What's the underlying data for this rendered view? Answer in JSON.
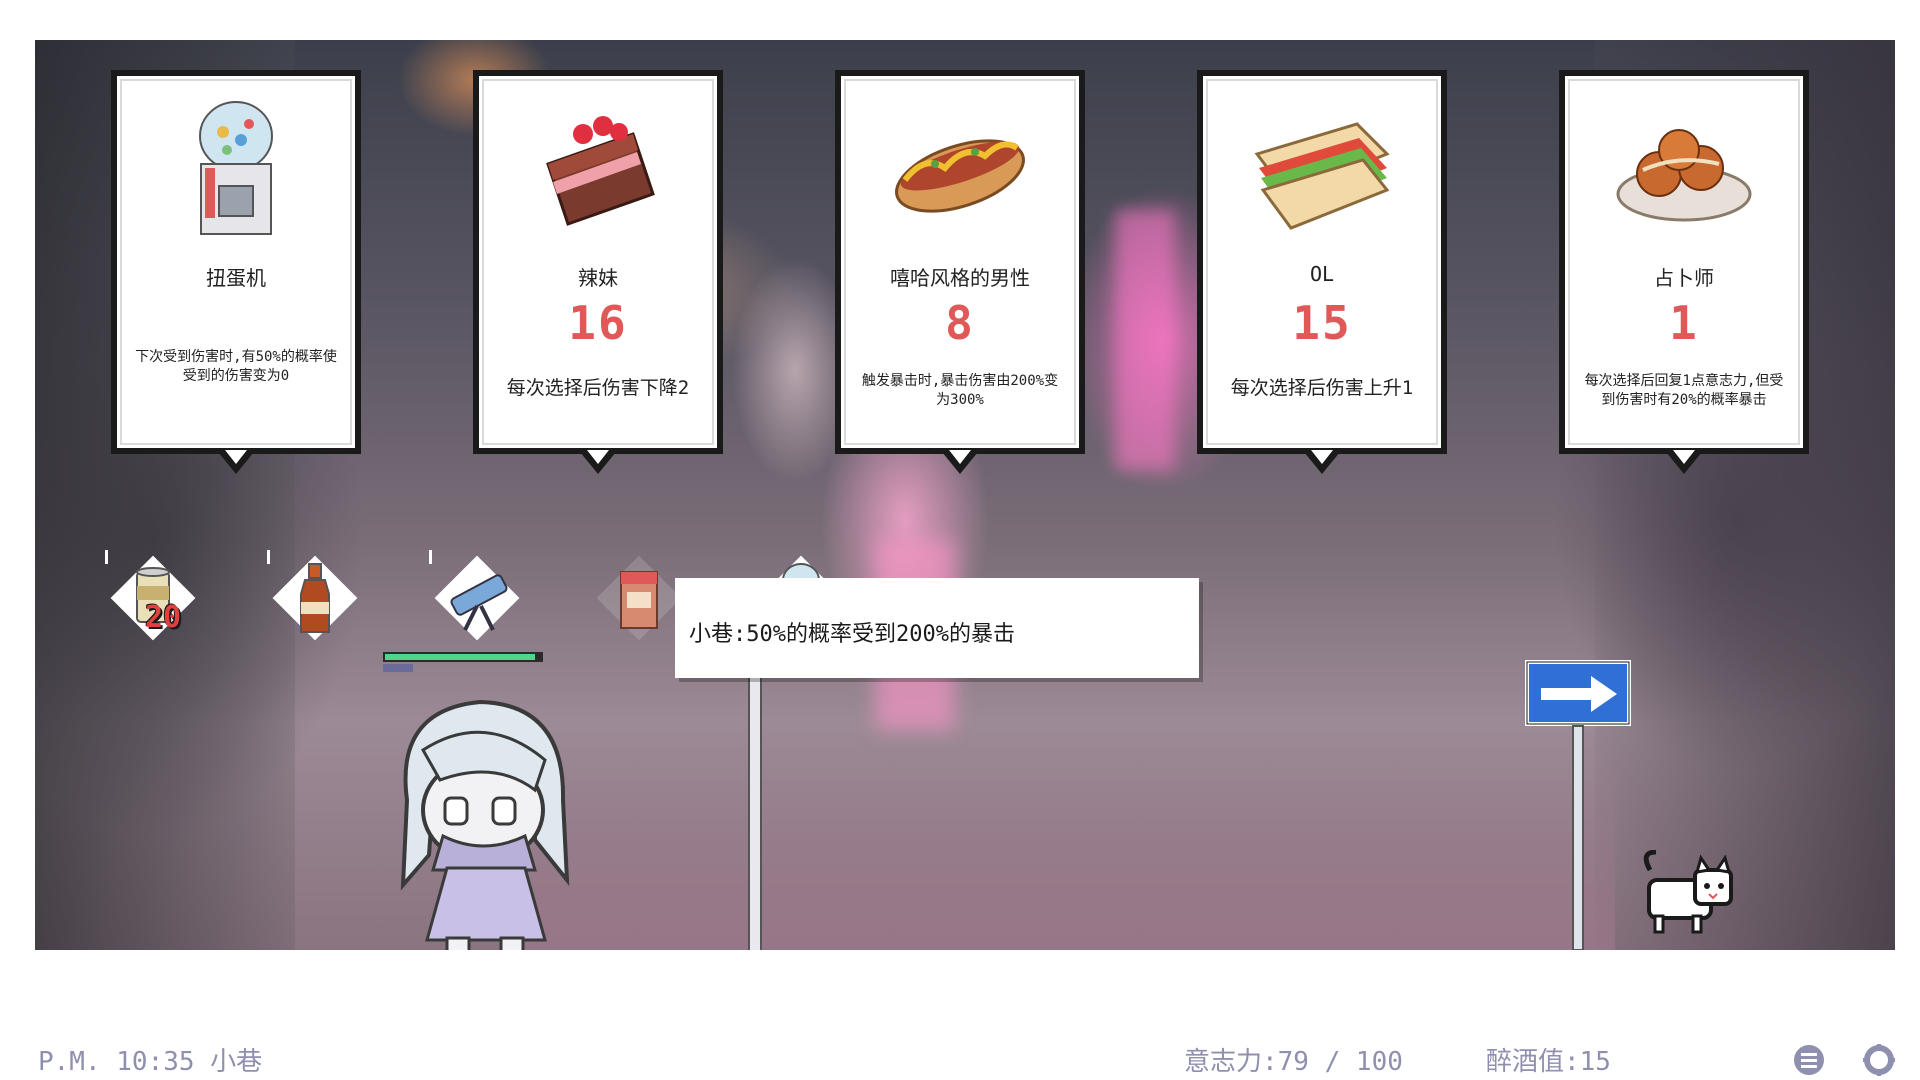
{
  "cards": [
    {
      "name": "扭蛋机",
      "value": "",
      "desc": "下次受到伤害时,有50%的概率使受到的伤害变为0",
      "art_icon": "gacha-machine-icon"
    },
    {
      "name": "辣妹",
      "value": "16",
      "desc": "每次选择后伤害下降2",
      "art_icon": "chocolate-cake-icon"
    },
    {
      "name": "嘻哈风格的男性",
      "value": "8",
      "desc": "触发暴击时,暴击伤害由200%变为300%",
      "art_icon": "hotdog-icon"
    },
    {
      "name": "OL",
      "value": "15",
      "desc": "每次选择后伤害上升1",
      "art_icon": "sandwich-icon"
    },
    {
      "name": "占卜师",
      "value": "1",
      "desc": "每次选择后回复1点意志力,但受到伤害时有20%的概率暴击",
      "art_icon": "takoyaki-icon"
    }
  ],
  "items": [
    {
      "icon": "beer-can-icon",
      "badge": "20"
    },
    {
      "icon": "soda-bottle-icon",
      "badge": ""
    },
    {
      "icon": "telescope-icon",
      "badge": ""
    },
    {
      "icon": "shop-stall-icon",
      "badge": ""
    },
    {
      "icon": "gacha-capsule-icon",
      "badge": ""
    }
  ],
  "tooltip": {
    "text": "小巷:50%的概率受到200%的暴击"
  },
  "player": {
    "health_fraction": 0.96
  },
  "status": {
    "time_location": "P.M. 10:35 小巷",
    "willpower": "意志力:79 / 100",
    "drunk": "醉酒值:15"
  },
  "colors": {
    "accent_value": "#e05858",
    "status_text": "#8f8fb0",
    "health": "#4fd68b",
    "sign_blue": "#2f6fd6"
  }
}
